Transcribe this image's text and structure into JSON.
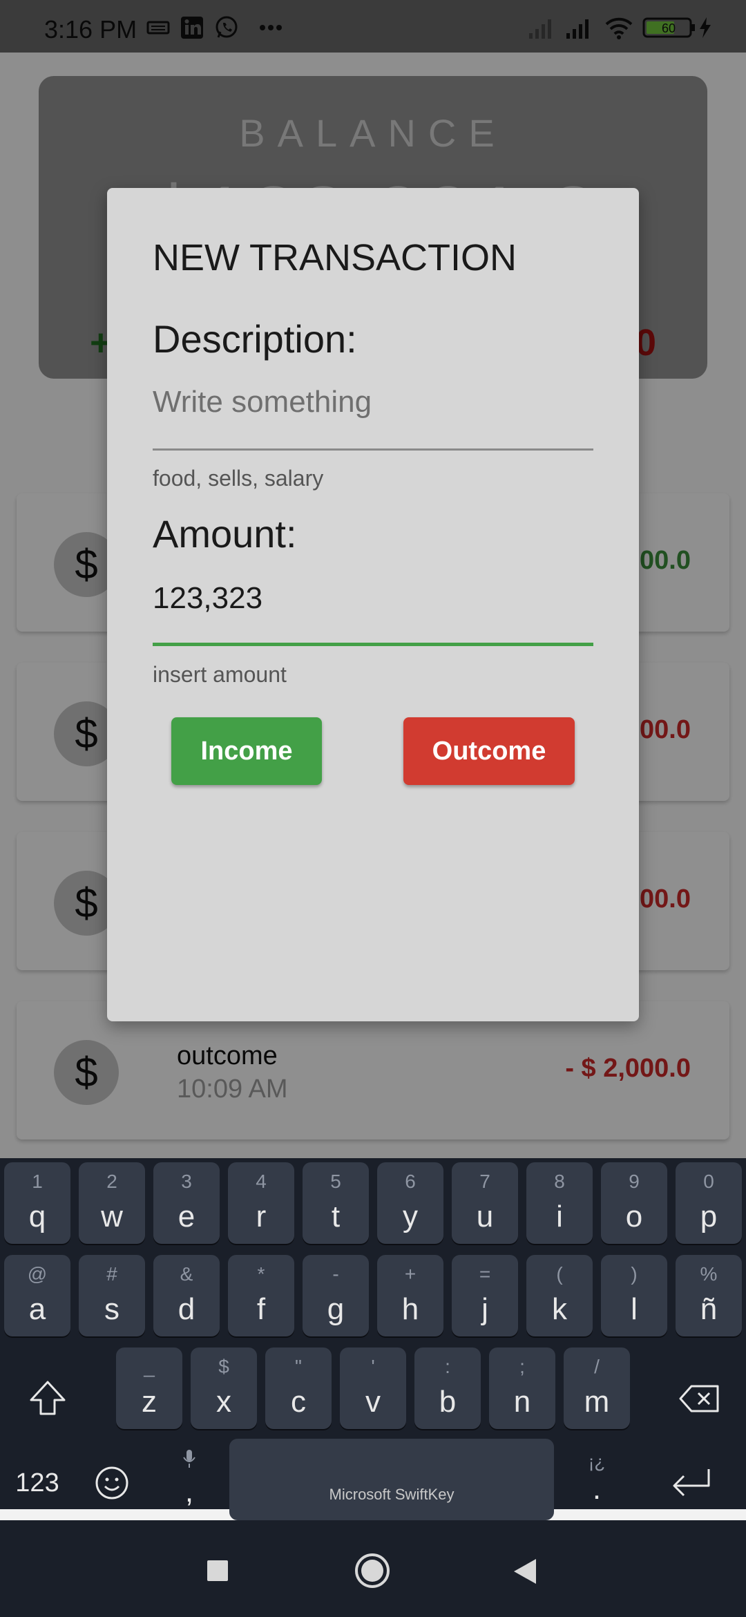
{
  "status_bar": {
    "time": "3:16 PM",
    "icons": [
      "keyboard-icon",
      "linkedin-icon",
      "whatsapp-icon",
      "more-dots-icon",
      "signal-off-icon",
      "signal-icon",
      "wifi-icon",
      "battery-icon",
      "charging-icon"
    ],
    "battery_level": "60"
  },
  "app": {
    "balance_title": "BALANCE",
    "balance_value": "$128,001.2",
    "income_total": "+",
    "outcome_total": "0",
    "transactions": [
      {
        "avatar": "$",
        "name": "",
        "time": "",
        "amount": "00.0",
        "type": "income"
      },
      {
        "avatar": "$",
        "name": "",
        "time": "",
        "amount": "00.0",
        "type": "outcome"
      },
      {
        "avatar": "$",
        "name": "",
        "time": "",
        "amount": "00.0",
        "type": "outcome"
      },
      {
        "avatar": "$",
        "name": "outcome",
        "time": "10:09 AM",
        "amount": "- $ 2,000.0",
        "type": "outcome"
      }
    ]
  },
  "dialog": {
    "title": "NEW TRANSACTION",
    "description_label": "Description:",
    "description_placeholder": "Write something",
    "description_value": "",
    "description_helper": "food, sells, salary",
    "amount_label": "Amount:",
    "amount_value": "123,323",
    "amount_helper": "insert amount",
    "income_button": "Income",
    "outcome_button": "Outcome",
    "colors": {
      "income": "#43a047",
      "outcome": "#d13b30",
      "focus_underline": "#43a047"
    }
  },
  "keyboard": {
    "row1": [
      {
        "main": "q",
        "sec": "1"
      },
      {
        "main": "w",
        "sec": "2"
      },
      {
        "main": "e",
        "sec": "3"
      },
      {
        "main": "r",
        "sec": "4"
      },
      {
        "main": "t",
        "sec": "5"
      },
      {
        "main": "y",
        "sec": "6"
      },
      {
        "main": "u",
        "sec": "7"
      },
      {
        "main": "i",
        "sec": "8"
      },
      {
        "main": "o",
        "sec": "9"
      },
      {
        "main": "p",
        "sec": "0"
      }
    ],
    "row2": [
      {
        "main": "a",
        "sec": "@"
      },
      {
        "main": "s",
        "sec": "#"
      },
      {
        "main": "d",
        "sec": "&"
      },
      {
        "main": "f",
        "sec": "*"
      },
      {
        "main": "g",
        "sec": "-"
      },
      {
        "main": "h",
        "sec": "+"
      },
      {
        "main": "j",
        "sec": "="
      },
      {
        "main": "k",
        "sec": "("
      },
      {
        "main": "l",
        "sec": ")"
      },
      {
        "main": "ñ",
        "sec": "%"
      }
    ],
    "row3": [
      {
        "main": "z",
        "sec": "_"
      },
      {
        "main": "x",
        "sec": "$"
      },
      {
        "main": "c",
        "sec": "\""
      },
      {
        "main": "v",
        "sec": "'"
      },
      {
        "main": "b",
        "sec": ":"
      },
      {
        "main": "n",
        "sec": ";"
      },
      {
        "main": "m",
        "sec": "/"
      }
    ],
    "numbers_key": "123",
    "comma_key": ",",
    "period_key": ".",
    "period_sec": "¡¿",
    "space_label": "Microsoft SwiftKey"
  },
  "nav": {
    "icons": [
      "recents-icon",
      "home-icon",
      "back-icon"
    ]
  }
}
